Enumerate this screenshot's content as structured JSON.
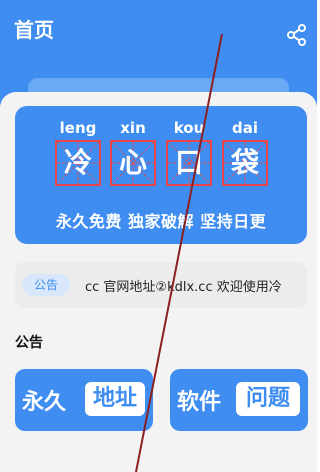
{
  "header": {
    "title": "首页",
    "share_icon": "share-icon"
  },
  "banner": {
    "pinyin": [
      "leng",
      "xin",
      "kou",
      "dai"
    ],
    "characters": [
      "冷",
      "心",
      "口",
      "袋"
    ],
    "slogan": "永久免费 独家破解 坚持日更",
    "grid_color": "#e8464a"
  },
  "notice": {
    "badge": "公告",
    "text": "cc 官网地址②kdlx.cc  欢迎使用冷"
  },
  "section": {
    "title": "公告"
  },
  "cards": [
    {
      "prefix": "永久",
      "highlight": "地址"
    },
    {
      "prefix": "软件",
      "highlight": "问题"
    }
  ],
  "colors": {
    "brand": "#3f8df0",
    "background": "#f3f3f3",
    "strike": "#8b2020"
  }
}
